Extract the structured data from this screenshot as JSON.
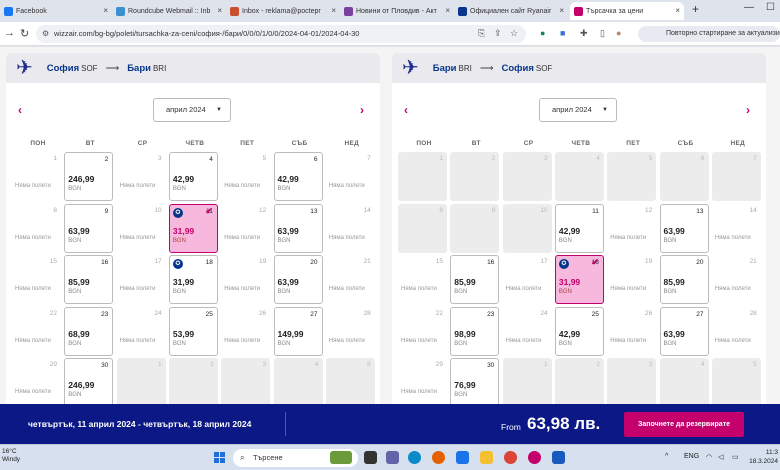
{
  "browser": {
    "tabs": [
      {
        "label": "Facebook",
        "color": "#1877f2"
      },
      {
        "label": "Roundcube Webmail :: Inb",
        "color": "#3a8fd0"
      },
      {
        "label": "Inbox - reklama@poctepr",
        "color": "#c94f2e"
      },
      {
        "label": "Новини от Пловдив - Акт",
        "color": "#7b3fa0"
      },
      {
        "label": "Официален сайт Ryanair",
        "color": "#073590"
      },
      {
        "label": "Търсачка за цени",
        "color": "#c3006b",
        "active": true
      }
    ],
    "url": "wizzair.com/bg-bg/poleti/tursachka-za-ceni/софия-/бари/0/0/0/1/0/0/2024-04-01/2024-04-30",
    "relaunch_label": "Повторно стартиране за актуализира",
    "new_tab": "+",
    "tab_close": "×",
    "win_min": "—",
    "win_max": "☐"
  },
  "outbound": {
    "from_city": "София",
    "from_code": "SOF",
    "to_city": "Бари",
    "to_code": "BRI",
    "month": "април 2024"
  },
  "inbound": {
    "from_city": "Бари",
    "from_code": "BRI",
    "to_city": "София",
    "to_code": "SOF",
    "month": "април 2024"
  },
  "weekdays": [
    "ПОН",
    "ВТ",
    "СР",
    "ЧЕТВ",
    "ПЕТ",
    "СЪБ",
    "НЕД"
  ],
  "labels": {
    "no_flights": "Няма полети",
    "currency": "BGN"
  },
  "outbound_days": [
    {
      "d": "1",
      "s": "none"
    },
    {
      "d": "2",
      "s": "avail",
      "p": "246,99"
    },
    {
      "d": "3",
      "s": "none"
    },
    {
      "d": "4",
      "s": "avail",
      "p": "42,99"
    },
    {
      "d": "5",
      "s": "none"
    },
    {
      "d": "6",
      "s": "avail",
      "p": "42,99"
    },
    {
      "d": "7",
      "s": "none"
    },
    {
      "d": "8",
      "s": "none"
    },
    {
      "d": "9",
      "s": "avail",
      "p": "63,99"
    },
    {
      "d": "10",
      "s": "none"
    },
    {
      "d": "11",
      "s": "sel",
      "p": "31,99",
      "check": true
    },
    {
      "d": "12",
      "s": "none"
    },
    {
      "d": "13",
      "s": "avail",
      "p": "63,99"
    },
    {
      "d": "14",
      "s": "none"
    },
    {
      "d": "15",
      "s": "none"
    },
    {
      "d": "16",
      "s": "avail",
      "p": "85,99"
    },
    {
      "d": "17",
      "s": "none"
    },
    {
      "d": "18",
      "s": "avail",
      "p": "31,99",
      "star": true
    },
    {
      "d": "19",
      "s": "none"
    },
    {
      "d": "20",
      "s": "avail",
      "p": "63,99"
    },
    {
      "d": "21",
      "s": "none"
    },
    {
      "d": "22",
      "s": "none"
    },
    {
      "d": "23",
      "s": "avail",
      "p": "68,99"
    },
    {
      "d": "24",
      "s": "none"
    },
    {
      "d": "25",
      "s": "avail",
      "p": "53,99"
    },
    {
      "d": "26",
      "s": "none"
    },
    {
      "d": "27",
      "s": "avail",
      "p": "149,99"
    },
    {
      "d": "28",
      "s": "none"
    },
    {
      "d": "29",
      "s": "none"
    },
    {
      "d": "30",
      "s": "avail",
      "p": "246,99"
    },
    {
      "d": "1",
      "s": "out"
    },
    {
      "d": "2",
      "s": "out"
    },
    {
      "d": "3",
      "s": "out"
    },
    {
      "d": "4",
      "s": "out"
    },
    {
      "d": "5",
      "s": "out"
    }
  ],
  "inbound_days": [
    {
      "d": "1",
      "s": "out"
    },
    {
      "d": "2",
      "s": "out"
    },
    {
      "d": "3",
      "s": "out"
    },
    {
      "d": "4",
      "s": "out"
    },
    {
      "d": "5",
      "s": "out"
    },
    {
      "d": "6",
      "s": "out"
    },
    {
      "d": "7",
      "s": "out"
    },
    {
      "d": "8",
      "s": "out"
    },
    {
      "d": "9",
      "s": "out"
    },
    {
      "d": "10",
      "s": "out"
    },
    {
      "d": "11",
      "s": "avail",
      "p": "42,99"
    },
    {
      "d": "12",
      "s": "none"
    },
    {
      "d": "13",
      "s": "avail",
      "p": "63,99"
    },
    {
      "d": "14",
      "s": "none"
    },
    {
      "d": "15",
      "s": "none"
    },
    {
      "d": "16",
      "s": "avail",
      "p": "85,99"
    },
    {
      "d": "17",
      "s": "none"
    },
    {
      "d": "18",
      "s": "sel",
      "p": "31,99",
      "check": true
    },
    {
      "d": "19",
      "s": "none"
    },
    {
      "d": "20",
      "s": "avail",
      "p": "85,99"
    },
    {
      "d": "21",
      "s": "none"
    },
    {
      "d": "22",
      "s": "none"
    },
    {
      "d": "23",
      "s": "avail",
      "p": "98,99"
    },
    {
      "d": "24",
      "s": "none"
    },
    {
      "d": "25",
      "s": "avail",
      "p": "42,99"
    },
    {
      "d": "26",
      "s": "none"
    },
    {
      "d": "27",
      "s": "avail",
      "p": "63,99"
    },
    {
      "d": "28",
      "s": "none"
    },
    {
      "d": "29",
      "s": "none"
    },
    {
      "d": "30",
      "s": "avail",
      "p": "76,99"
    },
    {
      "d": "1",
      "s": "out"
    },
    {
      "d": "2",
      "s": "out"
    },
    {
      "d": "3",
      "s": "out"
    },
    {
      "d": "4",
      "s": "out"
    },
    {
      "d": "5",
      "s": "out"
    }
  ],
  "footer": {
    "dates": "четвъртък, 11 април 2024 - четвъртък, 18 април 2024",
    "from_label": "From",
    "price": "63,98 лв.",
    "cta": "Започнете да резервирате"
  },
  "taskbar": {
    "temp": "16°C",
    "weather": "Windy",
    "search": "Търсене",
    "lang": "ENG",
    "time": "11:3",
    "date": "18.3.2024"
  },
  "colors": {
    "brand": "#c3006b",
    "navy": "#0c1885"
  }
}
